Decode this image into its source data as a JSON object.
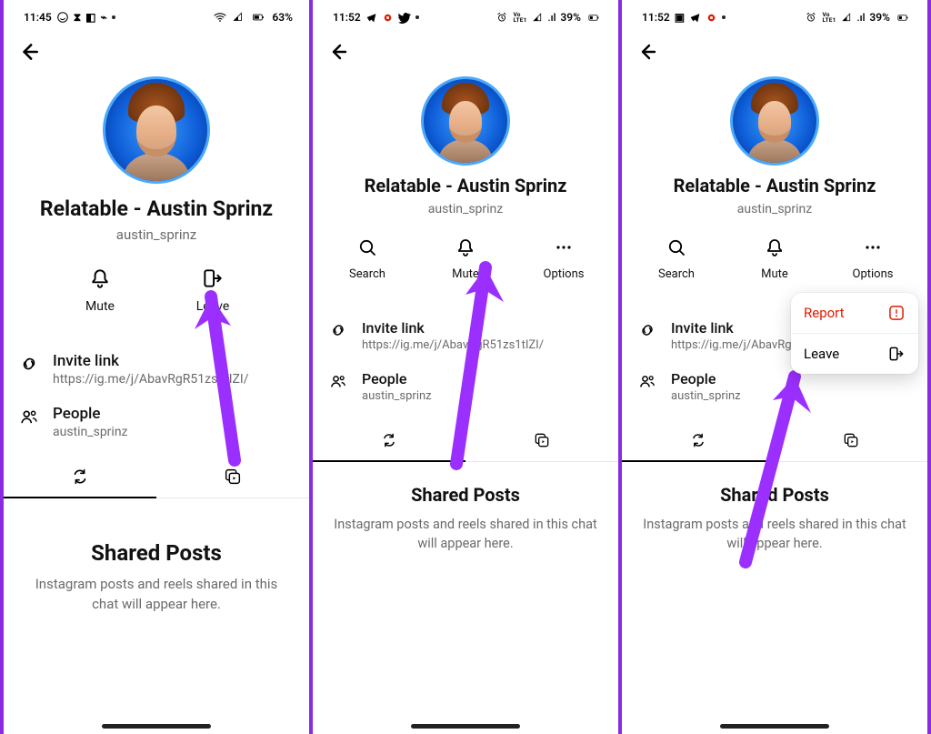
{
  "panel1": {
    "status": {
      "time": "11:45",
      "battery": "63%"
    },
    "title": "Relatable - Austin Sprinz",
    "username": "austin_sprinz",
    "actions": {
      "mute": "Mute",
      "leave": "Leave"
    },
    "invite": {
      "label": "Invite link",
      "url": "https://ig.me/j/AbavRgR51zs1tIZI/"
    },
    "people": {
      "label": "People",
      "value": "austin_sprinz"
    },
    "shared": {
      "heading": "Shared Posts",
      "body": "Instagram posts and reels shared in this chat will appear here."
    }
  },
  "panel2": {
    "status": {
      "time": "11:52",
      "battery": "39%"
    },
    "title": "Relatable - Austin Sprinz",
    "username": "austin_sprinz",
    "actions": {
      "search": "Search",
      "mute": "Mute",
      "options": "Options"
    },
    "invite": {
      "label": "Invite link",
      "url": "https://ig.me/j/AbavRgR51zs1tIZI/"
    },
    "people": {
      "label": "People",
      "value": "austin_sprinz"
    },
    "shared": {
      "heading": "Shared Posts",
      "body": "Instagram posts and reels shared in this chat will appear here."
    }
  },
  "panel3": {
    "status": {
      "time": "11:52",
      "battery": "39%"
    },
    "title": "Relatable - Austin Sprinz",
    "username": "austin_sprinz",
    "actions": {
      "search": "Search",
      "mute": "Mute",
      "options": "Options"
    },
    "invite": {
      "label": "Invite link",
      "url": "https://ig.me/j/AbavRgR5"
    },
    "people": {
      "label": "People",
      "value": "austin_sprinz"
    },
    "menu": {
      "report": "Report",
      "leave": "Leave"
    },
    "shared": {
      "heading": "Shared Posts",
      "body": "Instagram posts and reels shared in this chat will appear here."
    }
  },
  "colors": {
    "accentArrow": "#9b2fff"
  }
}
